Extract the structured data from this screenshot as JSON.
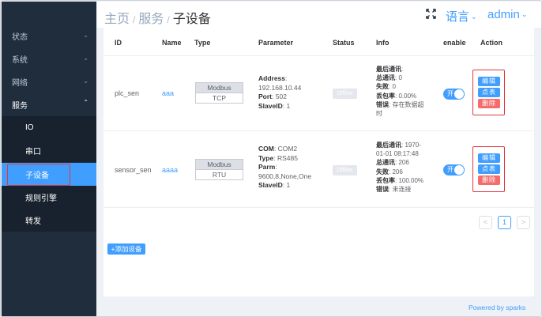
{
  "sidebar": {
    "items": [
      {
        "label": "状态"
      },
      {
        "label": "系统"
      },
      {
        "label": "网络"
      },
      {
        "label": "服务"
      }
    ],
    "sub_items": [
      {
        "label": "IO"
      },
      {
        "label": "串口"
      },
      {
        "label": "子设备"
      },
      {
        "label": "规则引擎"
      },
      {
        "label": "转发"
      }
    ],
    "active_sub": "子设备"
  },
  "header": {
    "breadcrumb": [
      "主页",
      "服务",
      "子设备"
    ],
    "language": "语言",
    "user": "admin"
  },
  "table": {
    "columns": [
      "ID",
      "Name",
      "Type",
      "Parameter",
      "Status",
      "Info",
      "enable",
      "Action"
    ],
    "rows": [
      {
        "id": "plc_sen",
        "name": "aaa",
        "type_top": "Modbus",
        "type_bottom": "TCP",
        "params": [
          {
            "label": "Address",
            "sep": ":",
            "value": ""
          },
          {
            "label": "",
            "sep": "",
            "value": "192.168.10.44"
          },
          {
            "label": "Port",
            "sep": ": ",
            "value": "502"
          },
          {
            "label": "SlaveID",
            "sep": ": ",
            "value": "1"
          }
        ],
        "status": "Offline",
        "info": [
          {
            "label": "最后通讯",
            "sep": ":",
            "value": ""
          },
          {
            "label": "总通讯",
            "sep": ": ",
            "value": "0"
          },
          {
            "label": "失败",
            "sep": ": ",
            "value": "0"
          },
          {
            "label": "丢包率",
            "sep": ": ",
            "value": "0.00%"
          },
          {
            "label": "错误",
            "sep": ": ",
            "value": "存在数据超"
          },
          {
            "label": "",
            "sep": "",
            "value": "时"
          }
        ],
        "enable": "开",
        "actions": [
          "编辑",
          "点表",
          "删除"
        ]
      },
      {
        "id": "sensor_sen",
        "name": "aaaa",
        "type_top": "Modbus",
        "type_bottom": "RTU",
        "params": [
          {
            "label": "COM",
            "sep": ": ",
            "value": "COM2"
          },
          {
            "label": "Type",
            "sep": ": ",
            "value": "RS485"
          },
          {
            "label": "Parm",
            "sep": ":",
            "value": ""
          },
          {
            "label": "",
            "sep": "",
            "value": "9600,8,None,One"
          },
          {
            "label": "SlaveID",
            "sep": ": ",
            "value": "1"
          }
        ],
        "status": "Offline",
        "info": [
          {
            "label": "最后通讯",
            "sep": ": ",
            "value": "1970-"
          },
          {
            "label": "",
            "sep": "",
            "value": "01-01 08:17:48"
          },
          {
            "label": "总通讯",
            "sep": ": ",
            "value": "206"
          },
          {
            "label": "失败",
            "sep": ": ",
            "value": "206"
          },
          {
            "label": "丢包率",
            "sep": ": ",
            "value": "100.00%"
          },
          {
            "label": "错误",
            "sep": ": ",
            "value": "未连接"
          }
        ],
        "enable": "开",
        "actions": [
          "编辑",
          "点表",
          "删除"
        ]
      }
    ]
  },
  "pagination": {
    "prev": "<",
    "current": "1",
    "next": ">"
  },
  "add_button": "+添加设备",
  "footer": "Powered by sparks",
  "colors": {
    "accent": "#409eff",
    "sidebar": "#1f2d3d",
    "danger": "#f56c6c",
    "highlight": "#e2373f"
  }
}
